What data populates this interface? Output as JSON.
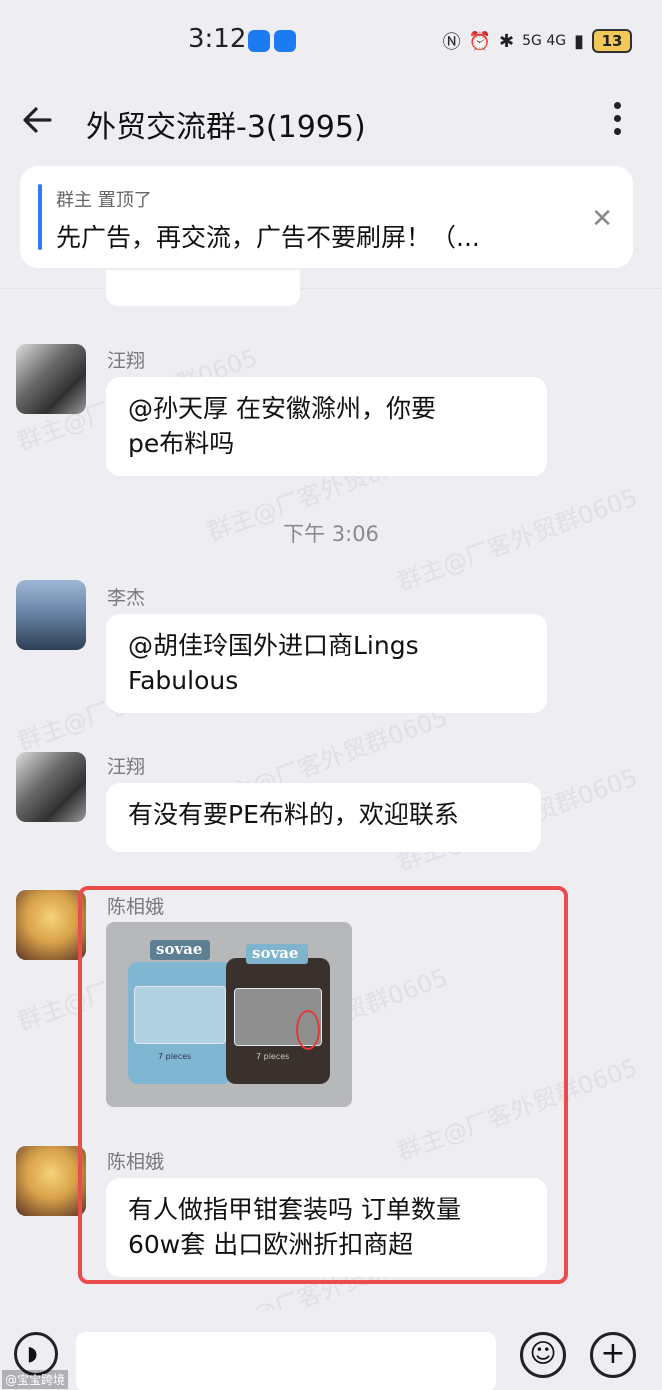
{
  "status": {
    "time": "3:12",
    "network": "5G 4G",
    "battery": "13"
  },
  "header": {
    "title": "外贸交流群-3(1995)"
  },
  "pinned": {
    "meta": "群主 置顶了",
    "text": "先广告，再交流，广告不要刷屏！（..."
  },
  "messages": [
    {
      "sender": "汪翔",
      "text": "@孙天厚  在安徽滁州，你要\npe布料吗"
    },
    {
      "time": "下午 3:06"
    },
    {
      "sender": "李杰",
      "text": "@胡佳玲国外进口商Lings\nFabulous"
    },
    {
      "sender": "汪翔",
      "text": "有没有要PE布料的，欢迎联系"
    },
    {
      "sender": "陈相娥",
      "image": {
        "brand": "sovae",
        "case_labels": [
          "7 pieces",
          "7 pieces"
        ]
      }
    },
    {
      "sender": "陈相娥",
      "text": "有人做指甲钳套装吗 订单数量\n60w套 出口欧洲折扣商超"
    }
  ],
  "watermark": "群主@厂客外贸群0605",
  "corner_mark": "@宝宝跨境",
  "colors": {
    "accent": "#2f7cf6",
    "highlight": "#ea4b4b",
    "background": "#ededf2"
  }
}
